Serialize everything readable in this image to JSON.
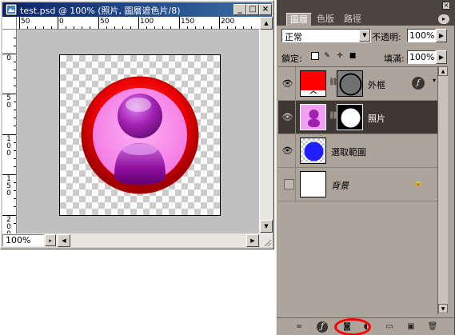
{
  "document": {
    "title": "test.psd @ 100% (照片, 圖層遮色片/8)",
    "zoom": "100%",
    "ruler_h_labels": [
      "50",
      "0",
      "50",
      "100",
      "150",
      "200"
    ],
    "ruler_v_labels": [
      {
        "chars": [
          "0"
        ]
      },
      {
        "chars": [
          "5",
          "0"
        ]
      },
      {
        "chars": [
          "1",
          "0",
          "0"
        ]
      },
      {
        "chars": [
          "1",
          "5",
          "0"
        ]
      },
      {
        "chars": [
          "2",
          "0",
          "0"
        ]
      }
    ]
  },
  "layers_panel": {
    "tabs": [
      "圖層",
      "色版",
      "路徑"
    ],
    "blend_mode": "正常",
    "opacity_label": "不透明:",
    "opacity_value": "100%",
    "lock_label": "鎖定:",
    "fill_label": "填滿:",
    "fill_value": "100%",
    "layers": [
      {
        "name": "外框",
        "visible": true,
        "selected": false,
        "has_mask": true,
        "has_fx": true,
        "locked": false,
        "thumb_color": "#ff0000"
      },
      {
        "name": "照片",
        "visible": true,
        "selected": true,
        "has_mask": true,
        "has_fx": false,
        "locked": false,
        "thumb_color": "#e040e0"
      },
      {
        "name": "選取範圍",
        "visible": true,
        "selected": false,
        "has_mask": false,
        "has_fx": false,
        "locked": false,
        "thumb_color": "#2020ff"
      },
      {
        "name": "背景",
        "visible": false,
        "selected": false,
        "has_mask": false,
        "has_fx": false,
        "locked": true,
        "thumb_color": "#ffffff"
      }
    ],
    "fx_symbol": "ƒ",
    "bottom_icons": [
      "link-layers-icon",
      "layer-style-icon",
      "add-layer-mask-icon",
      "adjustment-layer-icon",
      "new-group-icon",
      "new-layer-icon",
      "delete-layer-icon"
    ],
    "highlight_color": "#ff0000"
  }
}
